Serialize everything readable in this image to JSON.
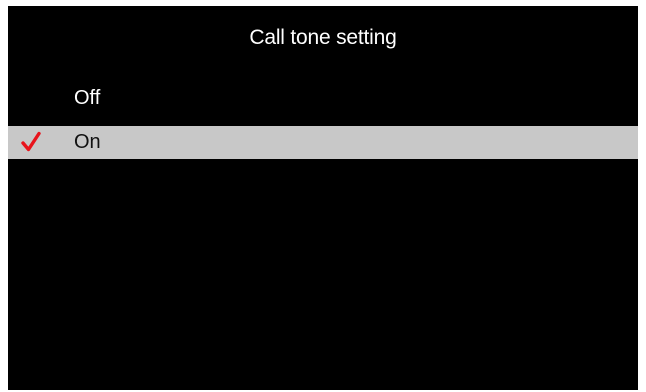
{
  "screen": {
    "title": "Call tone setting"
  },
  "menu": {
    "items": [
      {
        "label": "Off",
        "selected": false
      },
      {
        "label": "On",
        "selected": true
      }
    ]
  },
  "colors": {
    "background": "#000000",
    "highlight": "#c8c8c8",
    "text": "#ffffff",
    "selected_text": "#111111",
    "checkmark": "#e8141c"
  },
  "icons": {
    "selected_marker": "checkmark-icon"
  }
}
